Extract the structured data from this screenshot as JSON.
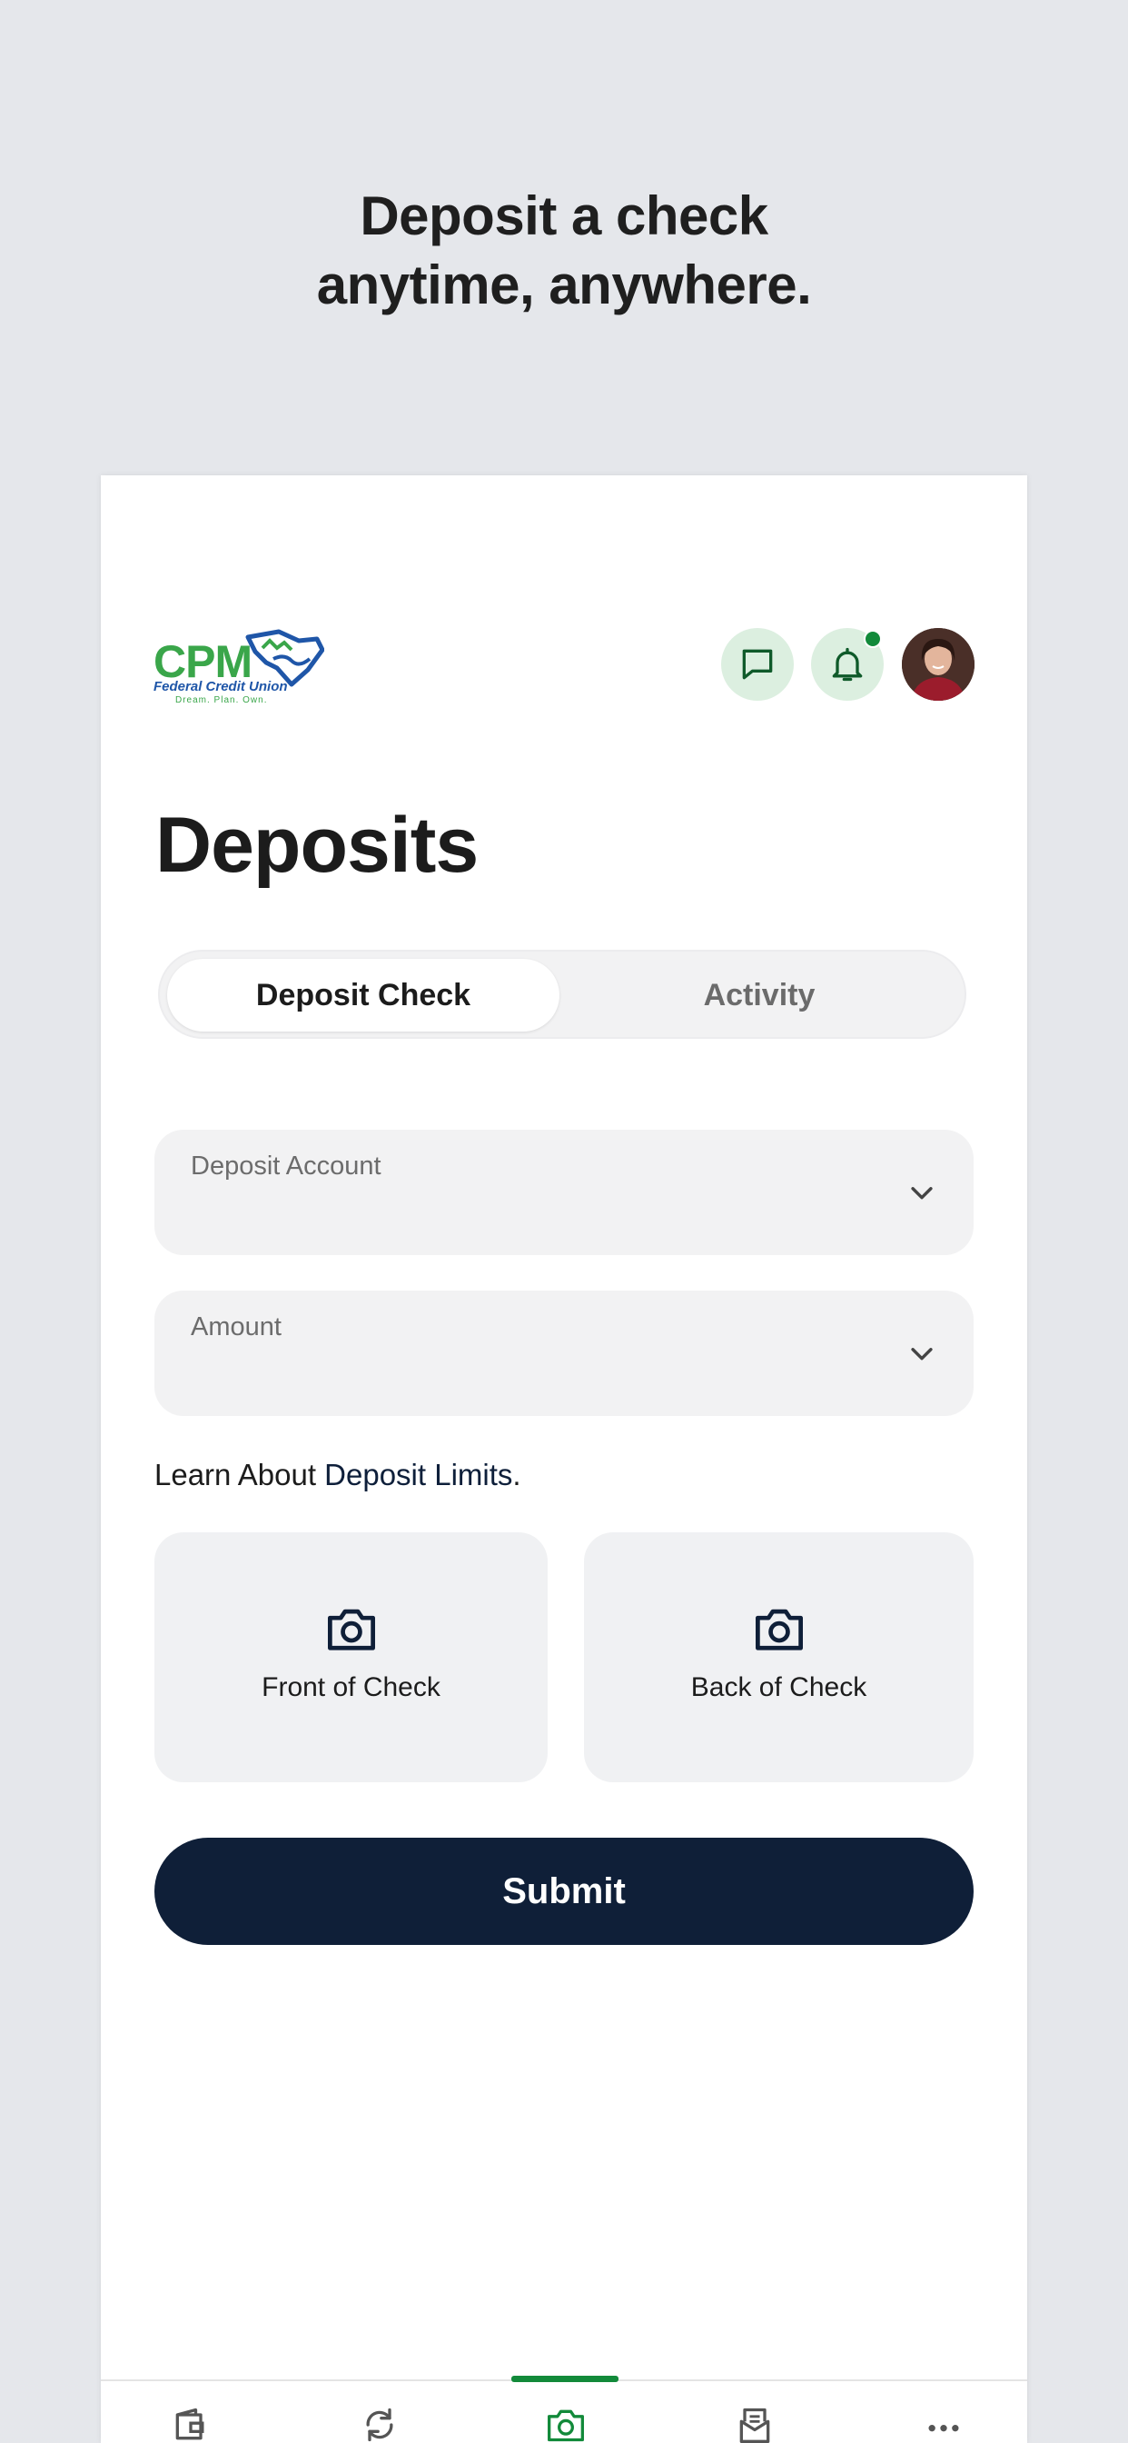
{
  "promo": {
    "headline_line1": "Deposit a check",
    "headline_line2": "anytime, anywhere."
  },
  "header": {
    "logo": {
      "name": "CPM",
      "subtitle": "Federal Credit Union",
      "tagline": "Dream. Plan. Own."
    },
    "icons": [
      "chat-icon",
      "bell-icon",
      "avatar"
    ],
    "notification_dot": true
  },
  "page": {
    "title": "Deposits"
  },
  "tabs": [
    {
      "label": "Deposit Check",
      "active": true
    },
    {
      "label": "Activity",
      "active": false
    }
  ],
  "form": {
    "deposit_account_label": "Deposit Account",
    "amount_label": "Amount",
    "limits_text": "Learn About ",
    "limits_link": "Deposit Limits",
    "limits_suffix": ".",
    "front_label": "Front of Check",
    "back_label": "Back of Check",
    "submit_label": "Submit"
  },
  "bottom_nav": {
    "items": [
      "wallet-icon",
      "transfer-icon",
      "camera-icon",
      "mail-icon",
      "more-icon"
    ],
    "active_index": 2
  },
  "colors": {
    "accent_green": "#128a3a",
    "navy": "#0f1f38",
    "background": "#e5e7eb"
  }
}
